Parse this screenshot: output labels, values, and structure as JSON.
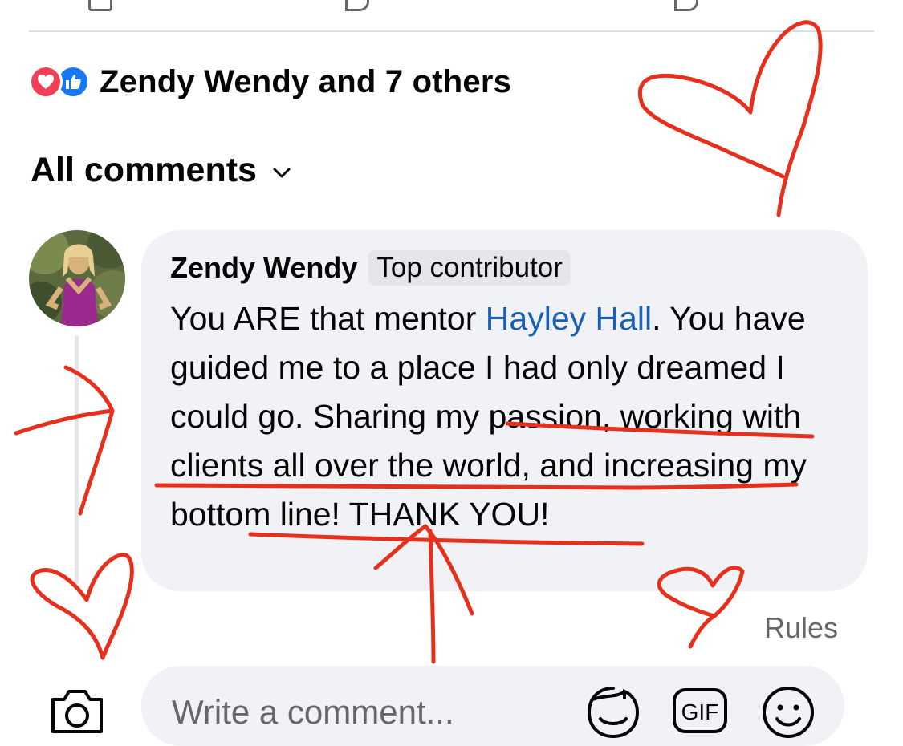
{
  "reactions": {
    "icons": [
      "heart-icon",
      "like-icon"
    ],
    "summary": "Zendy Wendy and 7 others"
  },
  "comments_filter": {
    "label": "All comments"
  },
  "comment": {
    "author": "Zendy Wendy",
    "badge": "Top contributor",
    "text_before": "You ARE that mentor ",
    "mention": "Hayley Hall",
    "text_after": ". You have guided me to a place I had only dreamed I could go. Sharing my passion, working with clients all over the world, and increasing my bottom line! THANK YOU!"
  },
  "rules_label": "Rules",
  "composer": {
    "placeholder": "Write a comment..."
  },
  "colors": {
    "like_blue": "#1877f2",
    "heart_red": "#f33e58",
    "mention_blue": "#1a5fb4",
    "bubble_bg": "#f0f2f5",
    "annotation_red": "#e5301d"
  }
}
